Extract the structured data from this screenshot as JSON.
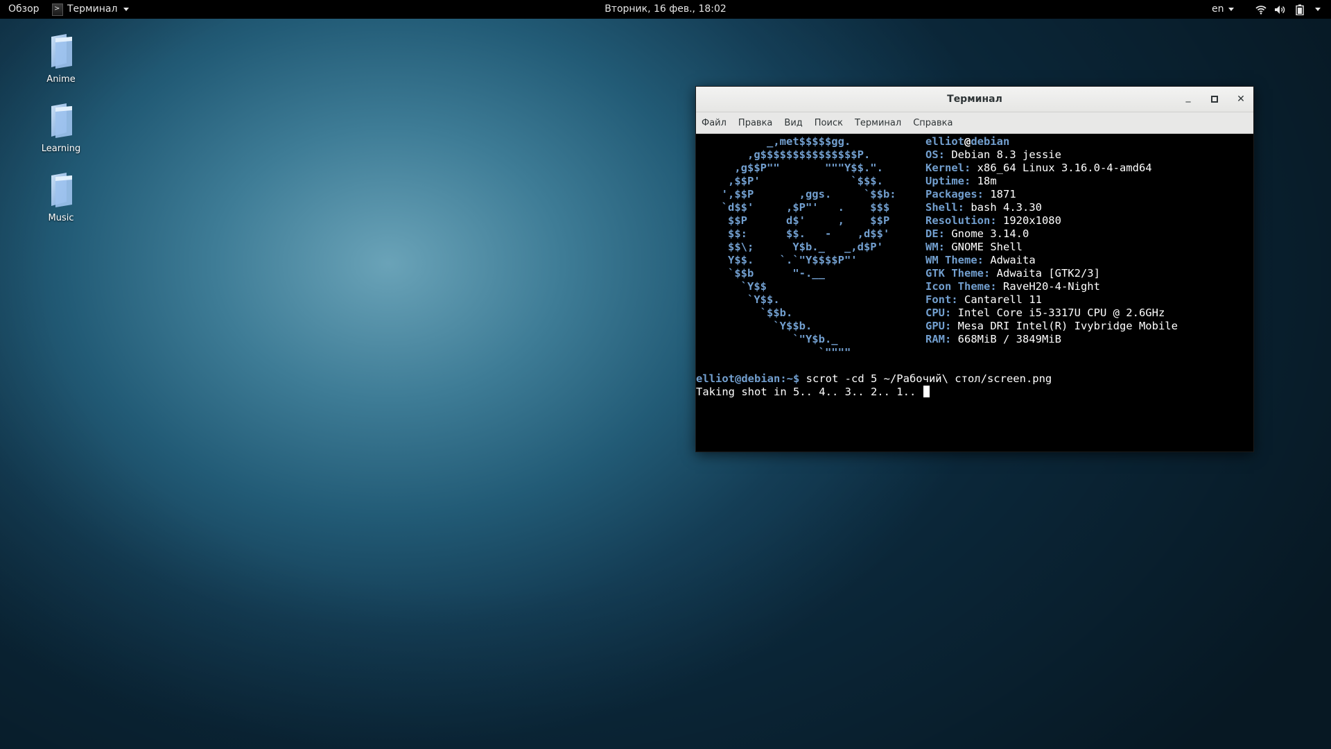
{
  "topbar": {
    "overview_label": "Обзор",
    "app_label": "Терминал",
    "clock": "Вторник, 16 фев., 18:02",
    "lang": "en",
    "icons": [
      "wifi-icon",
      "volume-icon",
      "battery-icon"
    ]
  },
  "desktop": {
    "icons": [
      {
        "label": "Anime",
        "icon": "folder-icon"
      },
      {
        "label": "Learning",
        "icon": "folder-icon"
      },
      {
        "label": "Music",
        "icon": "folder-icon"
      }
    ]
  },
  "window": {
    "title": "Терминал",
    "controls": {
      "minimize": "_",
      "maximize": "▫",
      "close": "✕"
    },
    "menu": [
      "Файл",
      "Правка",
      "Вид",
      "Поиск",
      "Терминал",
      "Справка"
    ]
  },
  "terminal": {
    "logo_lines": [
      "         _,met$$$$$gg.",
      "      ,g$$$$$$$$$$$$$$$P.",
      "    ,g$$P\"\"       \"\"\"Y$$.\".",
      "   ,$$P'              `$$$.",
      "  ',$$P       ,ggs.     `$$b:",
      "  `d$$'     ,$P\"'   .    $$$",
      "   $$P      d$'     ,    $$P",
      "   $$:      $$.   -    ,d$$'",
      "   $$\\;      Y$b._   _,d$P'",
      "   Y$$.    `.`\"Y$$$$P\"'",
      "   `$$b      \"-.__",
      "     `Y$$",
      "      `Y$$.",
      "        `$$b.",
      "          `Y$$b.",
      "             `\"Y$b._",
      "                 `\"\"\"\""
    ],
    "header_user": "elliot",
    "header_at": "@",
    "header_host": "debian",
    "info": [
      {
        "key": "OS:",
        "value": " Debian 8.3 jessie"
      },
      {
        "key": "Kernel:",
        "value": " x86_64 Linux 3.16.0-4-amd64"
      },
      {
        "key": "Uptime:",
        "value": " 18m"
      },
      {
        "key": "Packages:",
        "value": " 1871"
      },
      {
        "key": "Shell:",
        "value": " bash 4.3.30"
      },
      {
        "key": "Resolution:",
        "value": " 1920x1080"
      },
      {
        "key": "DE:",
        "value": " Gnome 3.14.0"
      },
      {
        "key": "WM:",
        "value": " GNOME Shell"
      },
      {
        "key": "WM Theme:",
        "value": " Adwaita"
      },
      {
        "key": "GTK Theme:",
        "value": " Adwaita [GTK2/3]"
      },
      {
        "key": "Icon Theme:",
        "value": " RaveH20-4-Night"
      },
      {
        "key": "Font:",
        "value": " Cantarell 11"
      },
      {
        "key": "CPU:",
        "value": " Intel Core i5-3317U CPU @ 2.6GHz"
      },
      {
        "key": "GPU:",
        "value": " Mesa DRI Intel(R) Ivybridge Mobile"
      },
      {
        "key": "RAM:",
        "value": " 668MiB / 3849MiB"
      }
    ],
    "prompt_user": "elliot@debian",
    "prompt_path": ":~$",
    "command": " scrot -cd 5 ~/Рабочий\\ стол/screen.png",
    "output": "Taking shot in 5.. 4.. 3.. 2.. 1.. "
  },
  "colors": {
    "accent_blue": "#729fcf",
    "terminal_bg": "#000000",
    "topbar_bg": "#000000"
  }
}
